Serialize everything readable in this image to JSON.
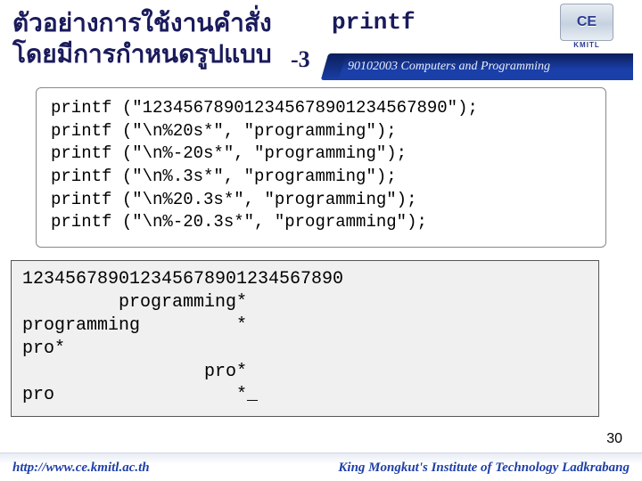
{
  "header": {
    "thai_line1": "ตัวอย่างการใช้งานคำสั่ง",
    "thai_line2": "โดยมีการกำหนดรูปแบบ",
    "code_kw": "printf",
    "part_num": "-3",
    "logo_text": "CE",
    "logo_sub": "KMITL",
    "course_strip": "90102003 Computers and Programming"
  },
  "code": {
    "lines": [
      "printf (\"123456789012345678901234567890\");",
      "printf (\"\\n%20s*\", \"programming\");",
      "printf (\"\\n%-20s*\", \"programming\");",
      "printf (\"\\n%.3s*\", \"programming\");",
      "printf (\"\\n%20.3s*\", \"programming\");",
      "printf (\"\\n%-20.3s*\", \"programming\");"
    ]
  },
  "output": {
    "lines": [
      "123456789012345678901234567890",
      "         programming*",
      "programming         *",
      "pro*",
      "                 pro*",
      "pro                 *_"
    ]
  },
  "slide_number": "30",
  "footer": {
    "left": "http://www.ce.kmitl.ac.th",
    "right": "King Mongkut's Institute of Technology Ladkrabang"
  }
}
